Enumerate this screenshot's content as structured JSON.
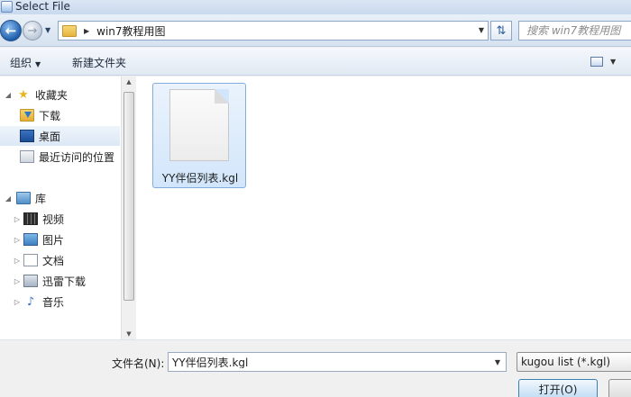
{
  "window": {
    "title": "Select File"
  },
  "address": {
    "path": "win7教程用图",
    "search_placeholder": "搜索 win7教程用图"
  },
  "toolbar": {
    "organize": "组织",
    "new_folder": "新建文件夹"
  },
  "nav": {
    "favorites": {
      "label": "收藏夹",
      "items": [
        {
          "label": "下载",
          "icon": "download-folder-icon"
        },
        {
          "label": "桌面",
          "icon": "desktop-icon"
        },
        {
          "label": "最近访问的位置",
          "icon": "recent-places-icon"
        }
      ]
    },
    "libraries": {
      "label": "库",
      "items": [
        {
          "label": "视频",
          "icon": "video-icon"
        },
        {
          "label": "图片",
          "icon": "pictures-icon"
        },
        {
          "label": "文档",
          "icon": "documents-icon"
        },
        {
          "label": "迅雷下载",
          "icon": "xunlei-download-icon"
        },
        {
          "label": "音乐",
          "icon": "music-icon"
        }
      ]
    }
  },
  "files": [
    {
      "name": "YY伴侣列表.kgl",
      "icon": "blank-file-icon"
    }
  ],
  "bottom": {
    "filename_label": "文件名(N):",
    "filename_value": "YY伴侣列表.kgl",
    "filter": "kugou list (*.kgl)",
    "open_label": "打开(O)"
  }
}
